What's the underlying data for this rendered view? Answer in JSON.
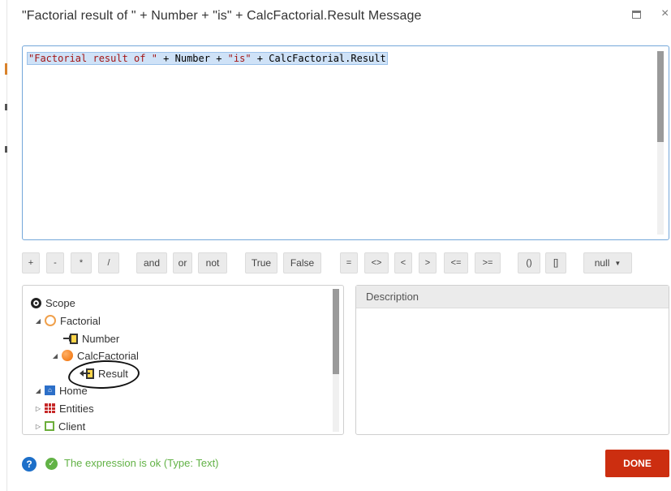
{
  "window": {
    "title": "\"Factorial result of \" + Number + \"is\" + CalcFactorial.Result Message",
    "close_glyph": "×"
  },
  "editor": {
    "tokens": [
      {
        "text": "\"Factorial result of \"",
        "kind": "string"
      },
      {
        "text": " + Number + ",
        "kind": "plain"
      },
      {
        "text": "\"is\"",
        "kind": "string"
      },
      {
        "text": " + CalcFactorial.Result",
        "kind": "plain"
      }
    ]
  },
  "operators": {
    "arith": [
      "+",
      "-",
      "*",
      "/"
    ],
    "logic": [
      "and",
      "or",
      "not"
    ],
    "bools": [
      "True",
      "False"
    ],
    "compare": [
      "=",
      "<>",
      "<",
      ">",
      "<=",
      ">="
    ],
    "brackets": [
      "()",
      "[]"
    ],
    "null_label": "null",
    "null_caret": "▼"
  },
  "scope": {
    "items": [
      {
        "label": "Scope",
        "icon": "scope-icon"
      },
      {
        "label": "Factorial",
        "icon": "action-icon",
        "arrow": "◢"
      },
      {
        "label": "Number",
        "icon": "input-parameter-icon"
      },
      {
        "label": "CalcFactorial",
        "icon": "action-node-icon",
        "arrow": "◢"
      },
      {
        "label": "Result",
        "icon": "output-parameter-icon"
      },
      {
        "label": "Home",
        "icon": "home-icon",
        "arrow": "◢"
      },
      {
        "label": "Entities",
        "icon": "entities-icon",
        "arrow": "▷"
      },
      {
        "label": "Client",
        "icon": "client-icon",
        "arrow": "▷"
      }
    ]
  },
  "description": {
    "header": "Description"
  },
  "footer": {
    "help_glyph": "?",
    "check_glyph": "✓",
    "status": "The expression is ok (Type: Text)",
    "done_label": "DONE"
  },
  "colors": {
    "accent_blue": "#1d6fc9",
    "ok_green": "#62b246",
    "done_red": "#cc2e10",
    "string_literal": "#a31515"
  }
}
